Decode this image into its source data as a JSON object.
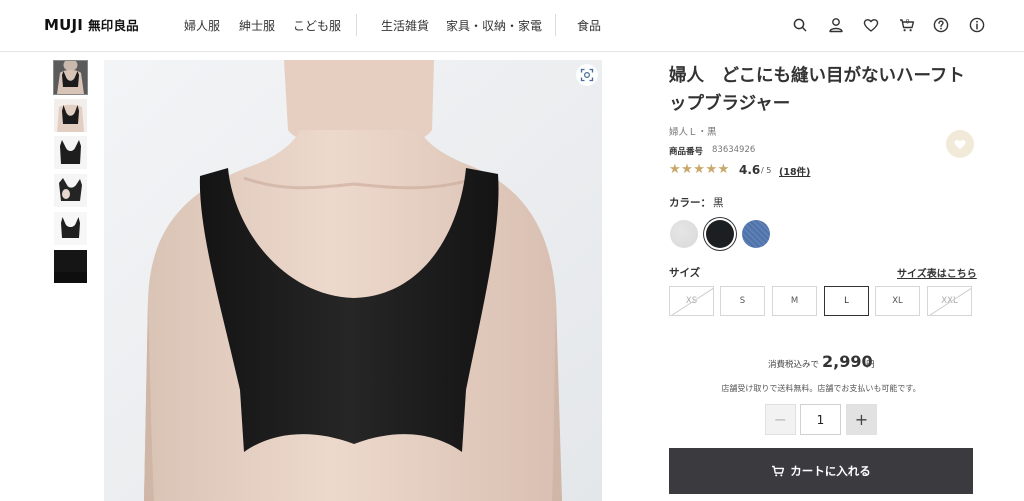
{
  "header": {
    "logo": "MUJI",
    "logo_jp": "無印良品",
    "nav": [
      "婦人服",
      "紳士服",
      "こども服",
      "生活雑貨",
      "家具・収納・家電",
      "食品"
    ],
    "cart_count": "0",
    "icons": [
      "search-icon",
      "user-icon",
      "heart-icon",
      "cart-icon",
      "help-icon",
      "info-icon"
    ]
  },
  "gallery": {
    "thumbnail_count": 6,
    "selected_thumbnail": 1
  },
  "product": {
    "title": "婦人　どこにも縫い目がないハーフトップブラジャー",
    "variant": "婦人Ｌ・黒",
    "product_number_label": "商品番号",
    "product_number": "83634926",
    "rating_value": 4.6,
    "rating": "4.6",
    "rating_max": "/ 5",
    "review_count": "(18件)",
    "stars": "★★★★★",
    "color_label": "カラー：",
    "color_value": "黒",
    "colors": [
      {
        "name": "gray",
        "hex": "#d8d8d8"
      },
      {
        "name": "black",
        "hex": "#1c1f22",
        "selected": true
      },
      {
        "name": "blue",
        "hex": "#4f72a8"
      }
    ],
    "size_label": "サイズ",
    "size_chart_link": "サイズ表はこちら",
    "sizes": [
      {
        "label": "XS",
        "available": false
      },
      {
        "label": "S",
        "available": true
      },
      {
        "label": "M",
        "available": true
      },
      {
        "label": "L",
        "available": true,
        "selected": true
      },
      {
        "label": "XL",
        "available": true
      },
      {
        "label": "XXL",
        "available": false
      }
    ],
    "tax_label": "消費税込みで",
    "price": "2,990",
    "currency": "円",
    "shipping_note": "店舗受け取りで送料無料。店舗でお支払いも可能です。",
    "quantity": "1",
    "qty_minus": "−",
    "qty_plus": "+",
    "cart_button": "カートに入れる"
  },
  "colors": {
    "accent_dark": "#3b3b3f",
    "star": "#c9a96b",
    "favorite_bg": "#f2ead9"
  }
}
